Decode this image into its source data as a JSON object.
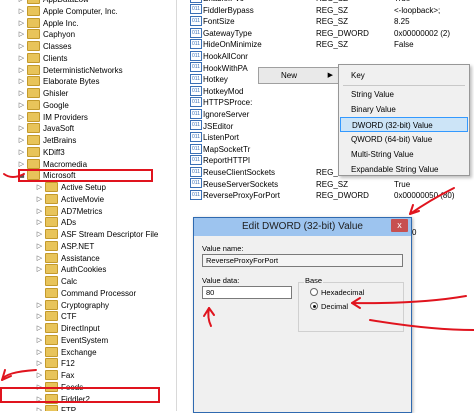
{
  "tree": {
    "items": [
      {
        "label": "AppDataLow",
        "indent": 1,
        "expander": "▷"
      },
      {
        "label": "Apple Computer, Inc.",
        "indent": 1,
        "expander": "▷"
      },
      {
        "label": "Apple Inc.",
        "indent": 1,
        "expander": "▷"
      },
      {
        "label": "Caphyon",
        "indent": 1,
        "expander": "▷"
      },
      {
        "label": "Classes",
        "indent": 1,
        "expander": "▷"
      },
      {
        "label": "Clients",
        "indent": 1,
        "expander": "▷"
      },
      {
        "label": "DeterministicNetworks",
        "indent": 1,
        "expander": "▷"
      },
      {
        "label": "Elaborate Bytes",
        "indent": 1,
        "expander": "▷"
      },
      {
        "label": "Ghisler",
        "indent": 1,
        "expander": "▷"
      },
      {
        "label": "Google",
        "indent": 1,
        "expander": "▷"
      },
      {
        "label": "IM Providers",
        "indent": 1,
        "expander": "▷"
      },
      {
        "label": "JavaSoft",
        "indent": 1,
        "expander": "▷"
      },
      {
        "label": "JetBrains",
        "indent": 1,
        "expander": "▷"
      },
      {
        "label": "KDiff3",
        "indent": 1,
        "expander": "▷"
      },
      {
        "label": "Macromedia",
        "indent": 1,
        "expander": "▷"
      },
      {
        "label": "Microsoft",
        "indent": 1,
        "expander": "◢"
      },
      {
        "label": "Active Setup",
        "indent": 2,
        "expander": "▷"
      },
      {
        "label": "ActiveMovie",
        "indent": 2,
        "expander": "▷"
      },
      {
        "label": "AD7Metrics",
        "indent": 2,
        "expander": "▷"
      },
      {
        "label": "ADs",
        "indent": 2,
        "expander": "▷"
      },
      {
        "label": "ASF Stream Descriptor File",
        "indent": 2,
        "expander": "▷"
      },
      {
        "label": "ASP.NET",
        "indent": 2,
        "expander": "▷"
      },
      {
        "label": "Assistance",
        "indent": 2,
        "expander": "▷"
      },
      {
        "label": "AuthCookies",
        "indent": 2,
        "expander": "▷"
      },
      {
        "label": "Calc",
        "indent": 2,
        "expander": ""
      },
      {
        "label": "Command Processor",
        "indent": 2,
        "expander": ""
      },
      {
        "label": "Cryptography",
        "indent": 2,
        "expander": "▷"
      },
      {
        "label": "CTF",
        "indent": 2,
        "expander": "▷"
      },
      {
        "label": "DirectInput",
        "indent": 2,
        "expander": "▷"
      },
      {
        "label": "EventSystem",
        "indent": 2,
        "expander": "▷"
      },
      {
        "label": "Exchange",
        "indent": 2,
        "expander": "▷"
      },
      {
        "label": "F12",
        "indent": 2,
        "expander": "▷"
      },
      {
        "label": "Fax",
        "indent": 2,
        "expander": "▷"
      },
      {
        "label": "Feeds",
        "indent": 2,
        "expander": "▷"
      },
      {
        "label": "Fiddler2",
        "indent": 2,
        "expander": "▷"
      },
      {
        "label": "FTP",
        "indent": 2,
        "expander": "▷"
      }
    ]
  },
  "values": {
    "rows": [
      {
        "name": "EnableIPv6",
        "type": "REG_SZ",
        "data": "True"
      },
      {
        "name": "FiddlerBypass",
        "type": "REG_SZ",
        "data": "<-loopback>;"
      },
      {
        "name": "FontSize",
        "type": "REG_SZ",
        "data": "8.25"
      },
      {
        "name": "GatewayType",
        "type": "REG_DWORD",
        "data": "0x00000002 (2)"
      },
      {
        "name": "HideOnMinimize",
        "type": "REG_SZ",
        "data": "False"
      },
      {
        "name": "HookAllConr",
        "type": "",
        "data": ""
      },
      {
        "name": "HookWithPA",
        "type": "",
        "data": ""
      },
      {
        "name": "Hotkey",
        "type": "",
        "data": ""
      },
      {
        "name": "HotkeyMod",
        "type": "",
        "data": ""
      },
      {
        "name": "HTTPSProce:",
        "type": "",
        "data": ""
      },
      {
        "name": "IgnoreServer",
        "type": "",
        "data": ""
      },
      {
        "name": "JSEditor",
        "type": "",
        "data": ""
      },
      {
        "name": "ListenPort",
        "type": "",
        "data": ""
      },
      {
        "name": "MapSocketTr",
        "type": "",
        "data": ""
      },
      {
        "name": "ReportHTTPI",
        "type": "",
        "data": ""
      },
      {
        "name": "ReuseClientSockets",
        "type": "REG_SZ",
        "data": "True"
      },
      {
        "name": "ReuseServerSockets",
        "type": "REG_SZ",
        "data": "True"
      },
      {
        "name": "ReverseProxyForPort",
        "type": "REG_DWORD",
        "data": "0x00000050 (80)"
      }
    ]
  },
  "menu_new": {
    "label": "New"
  },
  "submenu": {
    "items": [
      {
        "label": "Key",
        "highlighted": false
      },
      {
        "label": "String Value",
        "highlighted": false
      },
      {
        "label": "Binary Value",
        "highlighted": false
      },
      {
        "label": "DWORD (32-bit) Value",
        "highlighted": true
      },
      {
        "label": "QWORD (64-bit) Value",
        "highlighted": false
      },
      {
        "label": "Multi-String Value",
        "highlighted": false
      },
      {
        "label": "Expandable String Value",
        "highlighted": false
      }
    ]
  },
  "dialog": {
    "title": "Edit DWORD (32-bit) Value",
    "close_glyph": "x",
    "value_name_label": "Value name:",
    "value_name": "ReverseProxyForPort",
    "value_data_label": "Value data:",
    "value_data": "80",
    "base_label": "Base",
    "hex_label": "Hexadecimal",
    "dec_label": "Decimal",
    "base_selected": "Decimal",
    "peek_text": "0"
  },
  "colors": {
    "annotation": "#e0141e",
    "highlight": "#cce4f7",
    "title_bar": "#9dc4ef"
  },
  "icons": {
    "folder": "folder-icon",
    "registry_value": "reg-binary-icon"
  }
}
